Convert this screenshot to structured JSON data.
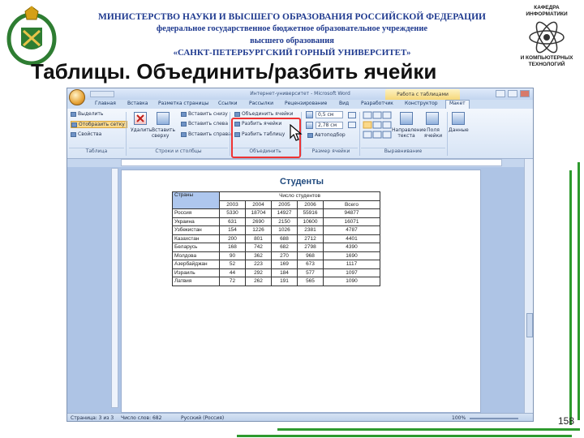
{
  "slide": {
    "header_lines": [
      "МИНИСТЕРСТВО НАУКИ И ВЫСШЕГО ОБРАЗОВАНИЯ РОССИЙСКОЙ ФЕДЕРАЦИИ",
      "федеральное государственное бюджетное образовательное учреждение",
      "высшего образования",
      "«САНКТ-ПЕТЕРБУРГСКИЙ ГОРНЫЙ УНИВЕРСИТЕТ»"
    ],
    "title": "Таблицы. Объединить/разбить ячейки",
    "logo_right_text": [
      "КАФЕДРА",
      "ИНФОРМАТИКИ",
      "И КОМПЬЮТЕРНЫХ",
      "ТЕХНОЛОГИЙ"
    ],
    "page_number": "158",
    "accent_color": "#2e9a2e"
  },
  "word": {
    "window_title": "Интернет-университет - Microsoft Word",
    "context_tab": "Работа с таблицами",
    "tabs": [
      "Главная",
      "Вставка",
      "Разметка страницы",
      "Ссылки",
      "Рассылки",
      "Рецензирование",
      "Вид",
      "Разработчик",
      "Конструктор",
      "Макет"
    ],
    "active_tab": "Макет",
    "ribbon": {
      "table_group": {
        "items": [
          "Выделить",
          "Отобразить сетку",
          "Свойства"
        ],
        "label": "Таблица"
      },
      "rows_cols_group": {
        "delete_label": "Удалить",
        "insert_above_label": "Вставить сверху",
        "items": [
          "Вставить снизу",
          "Вставить слева",
          "Вставить справа"
        ],
        "label": "Строки и столбцы"
      },
      "merge_group": {
        "items": [
          "Объединить ячейки",
          "Разбить ячейки",
          "Разбить таблицу"
        ],
        "label": "Объединить"
      },
      "cell_size_group": {
        "height_value": "0,5 см",
        "width_value": "2,78 см",
        "autofit_label": "Автоподбор",
        "label": "Размер ячейки"
      },
      "alignment_group": {
        "direction_label": "Направление текста",
        "margins_label": "Поля ячейки",
        "label": "Выравнивание"
      },
      "data_group": {
        "data_label": "Данные"
      }
    },
    "statusbar": {
      "page": "Страница: 3 из 3",
      "words": "Число слов: 682",
      "language": "Русский (Россия)",
      "zoom": "100%"
    },
    "document": {
      "title": "Студенты",
      "header_country": "Страны",
      "header_group": "Число студентов",
      "years": [
        "2003",
        "2004",
        "2005",
        "2006"
      ],
      "total_label": "Всего",
      "rows": [
        {
          "country": "Россия",
          "values": [
            "5330",
            "18704",
            "14927",
            "55916"
          ],
          "total": "94877"
        },
        {
          "country": "Украина",
          "values": [
            "631",
            "2690",
            "2150",
            "10600"
          ],
          "total": "16071"
        },
        {
          "country": "Узбекистан",
          "values": [
            "154",
            "1226",
            "1026",
            "2381"
          ],
          "total": "4787"
        },
        {
          "country": "Казахстан",
          "values": [
            "200",
            "801",
            "688",
            "2712"
          ],
          "total": "4401"
        },
        {
          "country": "Беларусь",
          "values": [
            "168",
            "742",
            "682",
            "2798"
          ],
          "total": "4390"
        },
        {
          "country": "Молдова",
          "values": [
            "90",
            "362",
            "270",
            "968"
          ],
          "total": "1690"
        },
        {
          "country": "Азербайджан",
          "values": [
            "52",
            "223",
            "169",
            "673"
          ],
          "total": "1117"
        },
        {
          "country": "Израиль",
          "values": [
            "44",
            "292",
            "184",
            "577"
          ],
          "total": "1097"
        },
        {
          "country": "Латвия",
          "values": [
            "72",
            "262",
            "191",
            "565"
          ],
          "total": "1090"
        }
      ]
    }
  }
}
